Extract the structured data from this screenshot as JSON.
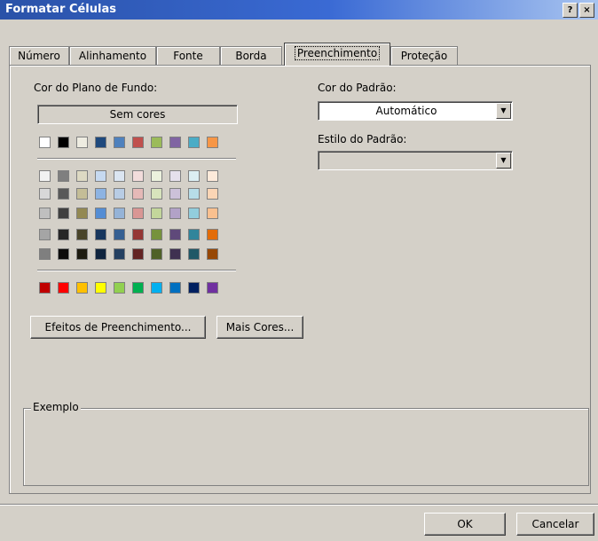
{
  "window": {
    "title": "Formatar Células",
    "help_label": "?",
    "close_label": "×"
  },
  "tabs": [
    {
      "label": "Número",
      "active": false
    },
    {
      "label": "Alinhamento",
      "active": false
    },
    {
      "label": "Fonte",
      "active": false
    },
    {
      "label": "Borda",
      "active": false
    },
    {
      "label": "Preenchimento",
      "active": true
    },
    {
      "label": "Proteção",
      "active": false
    }
  ],
  "fill": {
    "background_color_label": "Cor do Plano de Fundo:",
    "no_color_label": "Sem cores",
    "theme_row": [
      "#ffffff",
      "#000000",
      "#eeece1",
      "#1f497d",
      "#4f81bd",
      "#c0504d",
      "#9bbb59",
      "#8064a2",
      "#4bacc6",
      "#f79646"
    ],
    "tint_rows": [
      [
        "#f2f2f2",
        "#7f7f7f",
        "#ddd9c3",
        "#c6d9f0",
        "#dbe5f1",
        "#f2dcdb",
        "#ebf1dd",
        "#e5e0ec",
        "#dbeef3",
        "#fdeada"
      ],
      [
        "#d8d8d8",
        "#595959",
        "#c4bd97",
        "#8db3e2",
        "#b8cce4",
        "#e5b9b7",
        "#d7e3bc",
        "#ccc1d9",
        "#b7dde8",
        "#fbd5b5"
      ],
      [
        "#bfbfbf",
        "#3f3f3f",
        "#938953",
        "#548dd4",
        "#95b3d7",
        "#d99694",
        "#c3d69b",
        "#b2a2c7",
        "#92cddc",
        "#fac08f"
      ],
      [
        "#a5a5a5",
        "#262626",
        "#494429",
        "#17365d",
        "#366092",
        "#953734",
        "#76923c",
        "#5f497a",
        "#31859b",
        "#e36c09"
      ],
      [
        "#7f7f7f",
        "#0c0c0c",
        "#1d1b10",
        "#0f243e",
        "#244061",
        "#632423",
        "#4f6128",
        "#3f3151",
        "#205867",
        "#974806"
      ]
    ],
    "standard_row": [
      "#c00000",
      "#ff0000",
      "#ffc000",
      "#ffff00",
      "#92d050",
      "#00b050",
      "#00b0f0",
      "#0070c0",
      "#002060",
      "#7030a0"
    ],
    "fill_effects_button": "Efeitos de Preenchimento...",
    "more_colors_button": "Mais Cores...",
    "pattern_color_label": "Cor do Padrão:",
    "pattern_color_value": "Automático",
    "pattern_style_label": "Estilo do Padrão:",
    "pattern_style_value": "",
    "sample_label": "Exemplo"
  },
  "footer": {
    "ok_label": "OK",
    "cancel_label": "Cancelar"
  }
}
